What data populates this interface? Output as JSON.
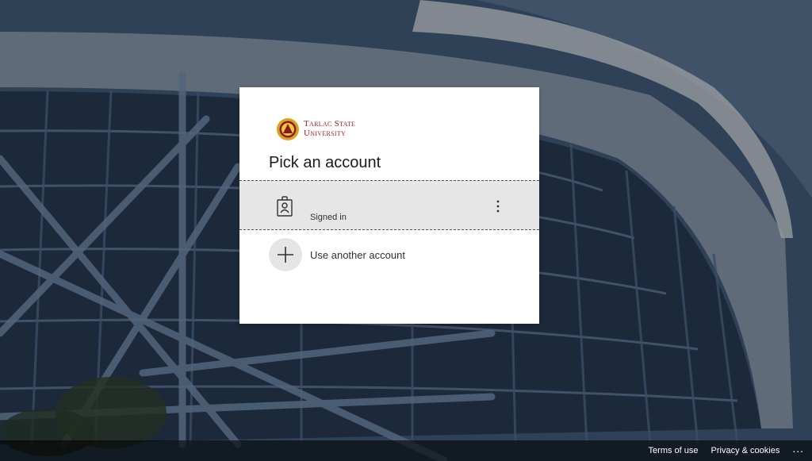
{
  "background": {
    "description_icon": "building-facade-image"
  },
  "logo": {
    "line1": "Tarlac State",
    "line2": "University",
    "brand_color": "#9b1b1b"
  },
  "dialog": {
    "title": "Pick an account",
    "accounts": [
      {
        "name": "",
        "status": "Signed in"
      }
    ],
    "add_account_label": "Use another account"
  },
  "footer": {
    "terms_label": "Terms of use",
    "privacy_label": "Privacy & cookies",
    "more_label": "..."
  }
}
